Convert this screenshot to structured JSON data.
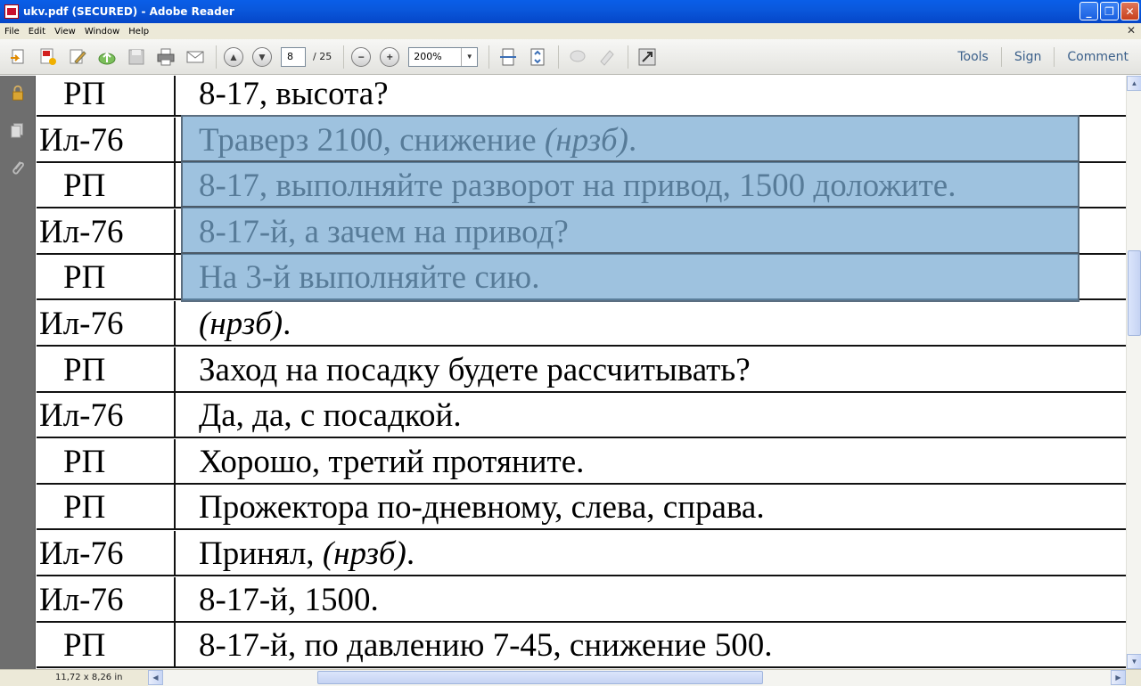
{
  "window": {
    "title": "ukv.pdf (SECURED) - Adobe Reader"
  },
  "menu": [
    "File",
    "Edit",
    "View",
    "Window",
    "Help"
  ],
  "toolbar": {
    "page_current": "8",
    "page_total": "/ 25",
    "zoom": "200%",
    "tools_label": "Tools",
    "sign_label": "Sign",
    "comment_label": "Comment"
  },
  "status": {
    "page_size": "11,72 x 8,26 in"
  },
  "transcript": [
    {
      "speaker": "РП",
      "text": "8-17, высота?"
    },
    {
      "speaker": "Ил-76",
      "text": "Траверз 2100, снижение ",
      "italic": "(нрзб)",
      "after": "."
    },
    {
      "speaker": "РП",
      "text": "8-17, выполняйте разворот на привод, 1500 доложите."
    },
    {
      "speaker": "Ил-76",
      "text": "8-17-й, а зачем на привод?"
    },
    {
      "speaker": "РП",
      "text": "На 3-й выполняйте сию."
    },
    {
      "speaker": "Ил-76",
      "text": "",
      "italic": "(нрзб)",
      "after": "."
    },
    {
      "speaker": "РП",
      "text": "Заход на посадку будете рассчитывать?"
    },
    {
      "speaker": "Ил-76",
      "text": "Да, да, с посадкой."
    },
    {
      "speaker": "РП",
      "text": "Хорошо, третий протяните."
    },
    {
      "speaker": "РП",
      "text": "Прожектора по-дневному, слева, справа."
    },
    {
      "speaker": "Ил-76",
      "text": "Принял, ",
      "italic": "(нрзб)",
      "after": "."
    },
    {
      "speaker": "Ил-76",
      "text": "8-17-й, 1500."
    },
    {
      "speaker": "РП",
      "text": "8-17-й, по давлению 7-45, снижение 500."
    }
  ],
  "colors": {
    "titlebar": "#0a58dc",
    "highlight": "#78aad2",
    "leftnav": "#6e6e6e"
  }
}
